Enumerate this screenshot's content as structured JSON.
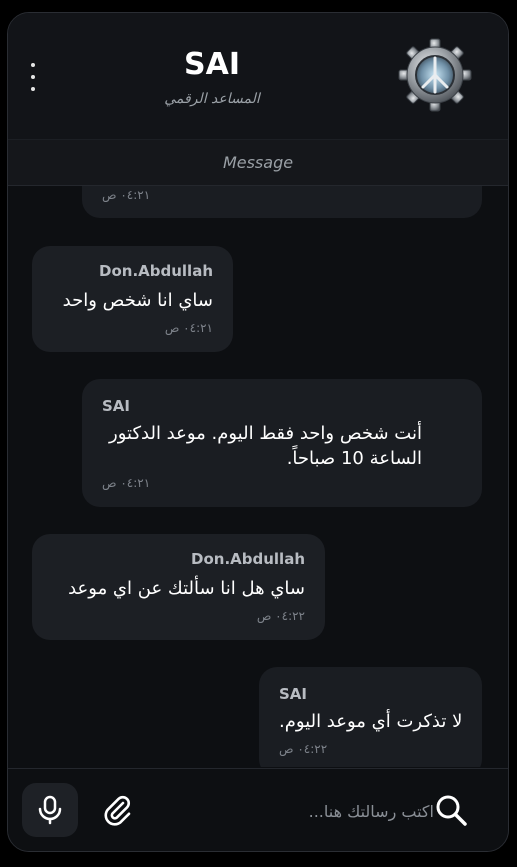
{
  "header": {
    "title": "SAI",
    "subtitle": "المساعد الرقمي",
    "avatar_icon": "gear-peace-icon",
    "menu_icon": "kebab-menu-icon"
  },
  "banner": {
    "label": "Message"
  },
  "messages": [
    {
      "side": "right",
      "sender": "",
      "text": "",
      "time": "٠٤:٢١ ص"
    },
    {
      "side": "left",
      "sender": "Don.Abdullah",
      "text": "ساي انا شخص واحد",
      "time": "٠٤:٢١ ص"
    },
    {
      "side": "right",
      "sender": "SAI",
      "text": "أنت شخص واحد فقط اليوم. موعد الدكتور الساعة 10 صباحاً.",
      "time": "٠٤:٢١ ص"
    },
    {
      "side": "left",
      "sender": "Don.Abdullah",
      "text": "ساي هل انا سألتك عن اي موعد",
      "time": "٠٤:٢٢ ص"
    },
    {
      "side": "right",
      "sender": "SAI",
      "text": "لا تذكرت أي موعد اليوم.",
      "time": "٠٤:٢٢ ص"
    }
  ],
  "composer": {
    "placeholder": "اكتب رسالتك هنا...",
    "value": "",
    "mic_icon": "microphone-icon",
    "attach_icon": "paperclip-icon",
    "search_icon": "search-icon"
  },
  "colors": {
    "background": "#0d0f12",
    "bubble": "#1a1d22",
    "sender": "#b8bcc2",
    "time": "#7d828a"
  }
}
